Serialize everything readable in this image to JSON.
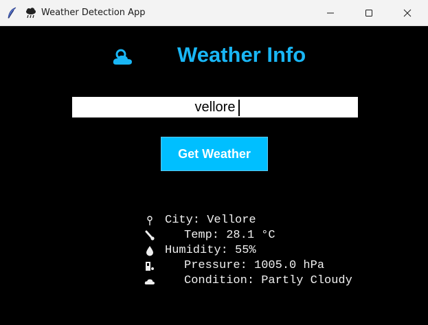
{
  "window": {
    "title": "Weather Detection App",
    "icons": [
      "feather-icon",
      "cloud-rain-icon"
    ]
  },
  "header": {
    "title": "Weather Info",
    "icon": "cloud-sun-icon",
    "accent_color": "#19b6f5"
  },
  "search": {
    "value": "vellore"
  },
  "button": {
    "label": "Get Weather",
    "color": "#00bfff"
  },
  "info": {
    "city": "City: Vellore",
    "temp": "Temp: 28.1 °C",
    "humidity": "Humidity: 55%",
    "pressure": "Pressure: 1005.0 hPa",
    "condition": "Condition: Partly Cloudy",
    "icons": [
      "pin-icon",
      "thermometer-icon",
      "droplet-icon",
      "gauge-icon",
      "cloud-icon"
    ]
  }
}
